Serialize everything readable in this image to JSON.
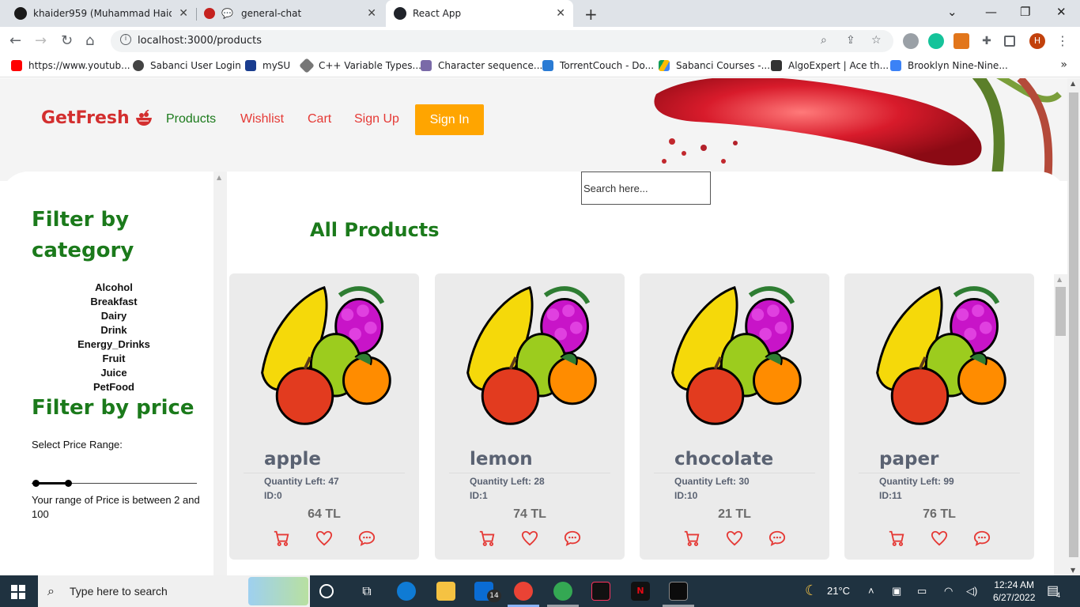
{
  "browser": {
    "tabs": [
      {
        "title": "khaider959 (Muhammad Haider",
        "active": false
      },
      {
        "title": "general-chat",
        "active": false
      },
      {
        "title": "React App",
        "active": true
      }
    ],
    "new_tab_label": "+",
    "url": "localhost:3000/products",
    "bookmarks": [
      {
        "label": "https://www.youtub...",
        "icon": "youtube-icon",
        "color": "#ff0000"
      },
      {
        "label": "Sabanci User Login",
        "icon": "globe-icon",
        "color": "#444444"
      },
      {
        "label": "mySU",
        "icon": "mysu-icon",
        "color": "#1a3d8f"
      },
      {
        "label": "C++ Variable Types...",
        "icon": "diamond-icon",
        "color": "#555555"
      },
      {
        "label": "Character sequence...",
        "icon": "cplusplus-icon",
        "color": "#7a6aa8"
      },
      {
        "label": "TorrentCouch - Do...",
        "icon": "torrentcouch-icon",
        "color": "#2a7bd4"
      },
      {
        "label": "Sabanci Courses -...",
        "icon": "google-drive-icon",
        "color": "#fbbc04"
      },
      {
        "label": "AlgoExpert | Ace th...",
        "icon": "algoexpert-icon",
        "color": "#333333"
      },
      {
        "label": "Brooklyn Nine-Nine...",
        "icon": "b99-icon",
        "color": "#3b82f6"
      }
    ],
    "profile_initial": "H"
  },
  "page": {
    "brand": "GetFresh",
    "nav": [
      {
        "label": "Products",
        "key": "products"
      },
      {
        "label": "Wishlist",
        "key": "wishlist"
      },
      {
        "label": "Cart",
        "key": "cart"
      },
      {
        "label": "Sign Up",
        "key": "signup"
      }
    ],
    "signin_label": "Sign In",
    "search_placeholder": "Search here...",
    "filter_category_title_1": "Filter by",
    "filter_category_title_2": "category",
    "categories": [
      "Alcohol",
      "Breakfast",
      "Dairy",
      "Drink",
      "Energy_Drinks",
      "Fruit",
      "Juice",
      "PetFood"
    ],
    "filter_price_title": "Filter by price",
    "price_range_label": "Select Price Range:",
    "price_range_min": 2,
    "price_range_max": 100,
    "price_range_text": "Your range of Price is between 2 and 100",
    "all_products_title": "All Products",
    "products": [
      {
        "name": "apple",
        "qty": "Quantity Left: 47",
        "id": "ID:0",
        "price": "64 TL"
      },
      {
        "name": "lemon",
        "qty": "Quantity Left: 28",
        "id": "ID:1",
        "price": "74 TL"
      },
      {
        "name": "chocolate",
        "qty": "Quantity Left: 30",
        "id": "ID:10",
        "price": "21 TL"
      },
      {
        "name": "paper",
        "qty": "Quantity Left: 99",
        "id": "ID:11",
        "price": "76 TL"
      }
    ]
  },
  "colors": {
    "brand_red": "#d32f2f",
    "nav_active_green": "#1b7a1b",
    "signin_orange": "#ffa500",
    "icon_red": "#e53935"
  },
  "taskbar": {
    "search_text": "Type here to search",
    "weather": "21°C",
    "time": "12:24 AM",
    "date": "6/27/2022",
    "mail_badge": "14",
    "notifications": "4"
  }
}
